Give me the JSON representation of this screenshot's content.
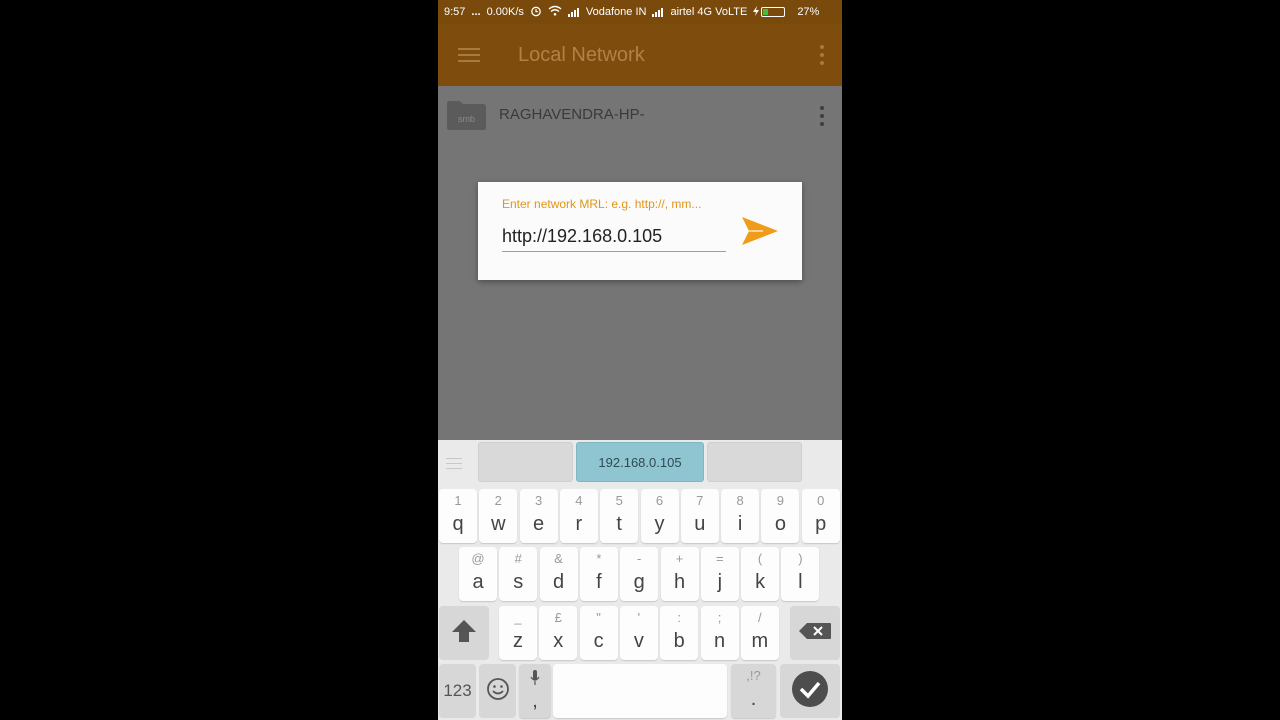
{
  "status_bar": {
    "time": "9:57",
    "dots": "...",
    "speed": "0.00K/s",
    "carrier1": "Vodafone IN",
    "carrier2": "airtel 4G VoLTE",
    "battery": "27%",
    "battery_level": 0.27
  },
  "app_bar": {
    "title": "Local Network",
    "menu_icon": "hamburger-icon",
    "overflow_icon": "more-vert-icon"
  },
  "browser": {
    "server": {
      "icon_label": "smb",
      "name": "RAGHAVENDRA-HP-"
    }
  },
  "dialog": {
    "hint": "Enter network MRL: e.g. http://, mm...",
    "input_value": "http://192.168.0.105",
    "send_icon": "send-icon"
  },
  "colors": {
    "accent": "#e39516",
    "app_bar": "#7e4c0d",
    "suggestion_highlight": "#8ec5d0"
  },
  "keyboard": {
    "suggestions": [
      "",
      "192.168.0.105",
      ""
    ],
    "row1": [
      {
        "key": "q",
        "alt": "1"
      },
      {
        "key": "w",
        "alt": "2"
      },
      {
        "key": "e",
        "alt": "3"
      },
      {
        "key": "r",
        "alt": "4"
      },
      {
        "key": "t",
        "alt": "5"
      },
      {
        "key": "y",
        "alt": "6"
      },
      {
        "key": "u",
        "alt": "7"
      },
      {
        "key": "i",
        "alt": "8"
      },
      {
        "key": "o",
        "alt": "9"
      },
      {
        "key": "p",
        "alt": "0"
      }
    ],
    "row2": [
      {
        "key": "a",
        "alt": "@"
      },
      {
        "key": "s",
        "alt": "#"
      },
      {
        "key": "d",
        "alt": "&"
      },
      {
        "key": "f",
        "alt": "*"
      },
      {
        "key": "g",
        "alt": "-"
      },
      {
        "key": "h",
        "alt": "+"
      },
      {
        "key": "j",
        "alt": "="
      },
      {
        "key": "k",
        "alt": "("
      },
      {
        "key": "l",
        "alt": ")"
      }
    ],
    "row3": [
      {
        "key": "z",
        "alt": "_"
      },
      {
        "key": "x",
        "alt": "£"
      },
      {
        "key": "c",
        "alt": "\""
      },
      {
        "key": "v",
        "alt": "'"
      },
      {
        "key": "b",
        "alt": ":"
      },
      {
        "key": "n",
        "alt": ";"
      },
      {
        "key": "m",
        "alt": "/"
      }
    ],
    "numbers_label": "123",
    "comma_label": ",",
    "period_label": ".",
    "punct_alt": ",!?"
  }
}
